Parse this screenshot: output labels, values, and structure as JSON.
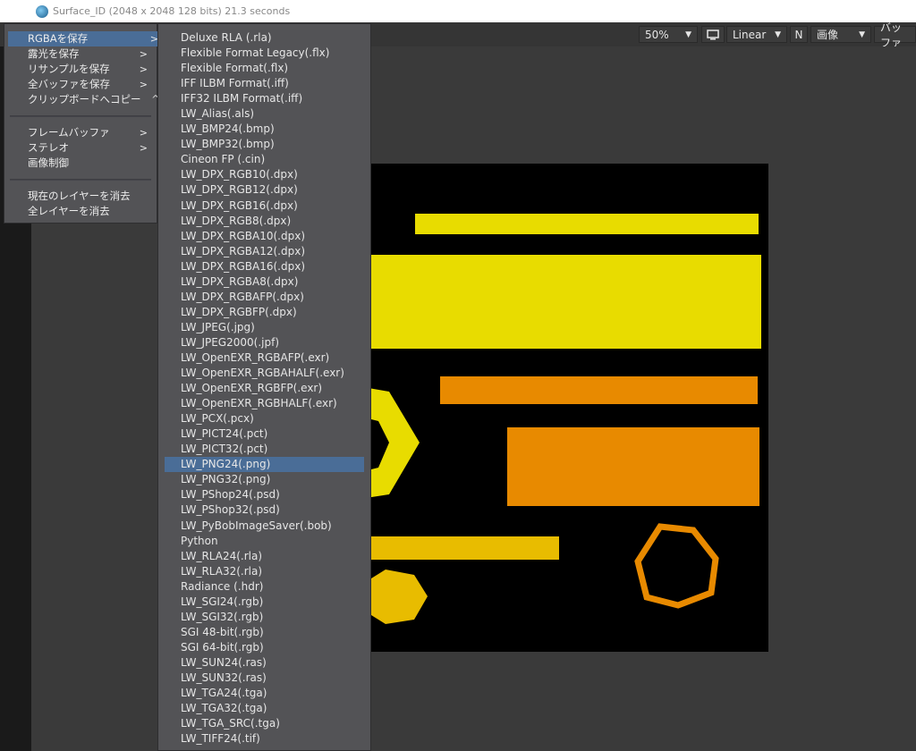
{
  "window": {
    "title": "Surface_ID (2048 x 2048 128 bits) 21.3 seconds"
  },
  "toolbar": {
    "zoom": "50%",
    "monitor_icon": "monitor-icon",
    "colorspace": "Linear",
    "n_label": "N",
    "image_select": "画像",
    "buffer_label": "バッファ"
  },
  "main_menu": {
    "items": [
      {
        "label": "RGBAを保存",
        "has_submenu": true,
        "active": true
      },
      {
        "label": "露光を保存",
        "has_submenu": true
      },
      {
        "label": "リサンプルを保存",
        "has_submenu": true
      },
      {
        "label": "全バッファを保存",
        "has_submenu": true
      },
      {
        "label": "クリップボードへコピー",
        "shortcut": "^C"
      }
    ],
    "items2": [
      {
        "label": "フレームバッファ",
        "has_submenu": true
      },
      {
        "label": "ステレオ",
        "has_submenu": true
      },
      {
        "label": "画像制御"
      }
    ],
    "items3": [
      {
        "label": "現在のレイヤーを消去"
      },
      {
        "label": "全レイヤーを消去"
      }
    ]
  },
  "submenu": {
    "items": [
      "Deluxe RLA (.rla)",
      "Flexible Format Legacy(.flx)",
      "Flexible Format(.flx)",
      "IFF ILBM Format(.iff)",
      "IFF32 ILBM Format(.iff)",
      "LW_Alias(.als)",
      "LW_BMP24(.bmp)",
      "LW_BMP32(.bmp)",
      "Cineon FP (.cin)",
      "LW_DPX_RGB10(.dpx)",
      "LW_DPX_RGB12(.dpx)",
      "LW_DPX_RGB16(.dpx)",
      "LW_DPX_RGB8(.dpx)",
      "LW_DPX_RGBA10(.dpx)",
      "LW_DPX_RGBA12(.dpx)",
      "LW_DPX_RGBA16(.dpx)",
      "LW_DPX_RGBA8(.dpx)",
      "LW_DPX_RGBAFP(.dpx)",
      "LW_DPX_RGBFP(.dpx)",
      "LW_JPEG(.jpg)",
      "LW_JPEG2000(.jpf)",
      "LW_OpenEXR_RGBAFP(.exr)",
      "LW_OpenEXR_RGBAHALF(.exr)",
      "LW_OpenEXR_RGBFP(.exr)",
      "LW_OpenEXR_RGBHALF(.exr)",
      "LW_PCX(.pcx)",
      "LW_PICT24(.pct)",
      "LW_PICT32(.pct)",
      "LW_PNG24(.png)",
      "LW_PNG32(.png)",
      "LW_PShop24(.psd)",
      "LW_PShop32(.psd)",
      "LW_PyBobImageSaver(.bob)",
      "Python",
      "LW_RLA24(.rla)",
      "LW_RLA32(.rla)",
      "Radiance (.hdr)",
      "LW_SGI24(.rgb)",
      "LW_SGI32(.rgb)",
      "SGI 48-bit(.rgb)",
      "SGI 64-bit(.rgb)",
      "LW_SUN24(.ras)",
      "LW_SUN32(.ras)",
      "LW_TGA24(.tga)",
      "LW_TGA32(.tga)",
      "LW_TGA_SRC(.tga)",
      "LW_TIFF24(.tif)"
    ],
    "active_index": 28
  },
  "colors": {
    "yellow": "#e8dc00",
    "orange": "#e88a00",
    "gold": "#e8bc00",
    "highlight": "#4a6d97"
  }
}
